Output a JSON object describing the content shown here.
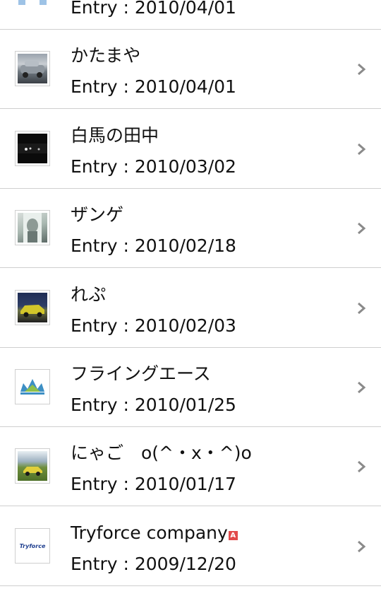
{
  "entries": [
    {
      "title": "",
      "entry": "Entry : 2010/04/01",
      "thumb": "partial-icon"
    },
    {
      "title": "かたまや",
      "entry": "Entry : 2010/04/01",
      "thumb": "grey-car-photo"
    },
    {
      "title": "白馬の田中",
      "entry": "Entry : 2010/03/02",
      "thumb": "night-scene-photo"
    },
    {
      "title": "ザンゲ",
      "entry": "Entry : 2010/02/18",
      "thumb": "person-photo"
    },
    {
      "title": "れぷ",
      "entry": "Entry : 2010/02/03",
      "thumb": "yellow-car-photo"
    },
    {
      "title": "フライングエース",
      "entry": "Entry : 2010/01/25",
      "thumb": "crown-logo"
    },
    {
      "title": "にゃご　o(^・x・^)o",
      "entry": "Entry : 2010/01/17",
      "thumb": "car-in-field-photo"
    },
    {
      "title": "Tryforce company",
      "entry": "Entry : 2009/12/20",
      "thumb": "tryforce-logo",
      "badge": "A",
      "logo_text": "Tryforce"
    }
  ],
  "colors": {
    "divider": "#cfcfcf",
    "chevron": "#8a8a8a",
    "badge": "#e24b4b",
    "text": "#111111"
  }
}
